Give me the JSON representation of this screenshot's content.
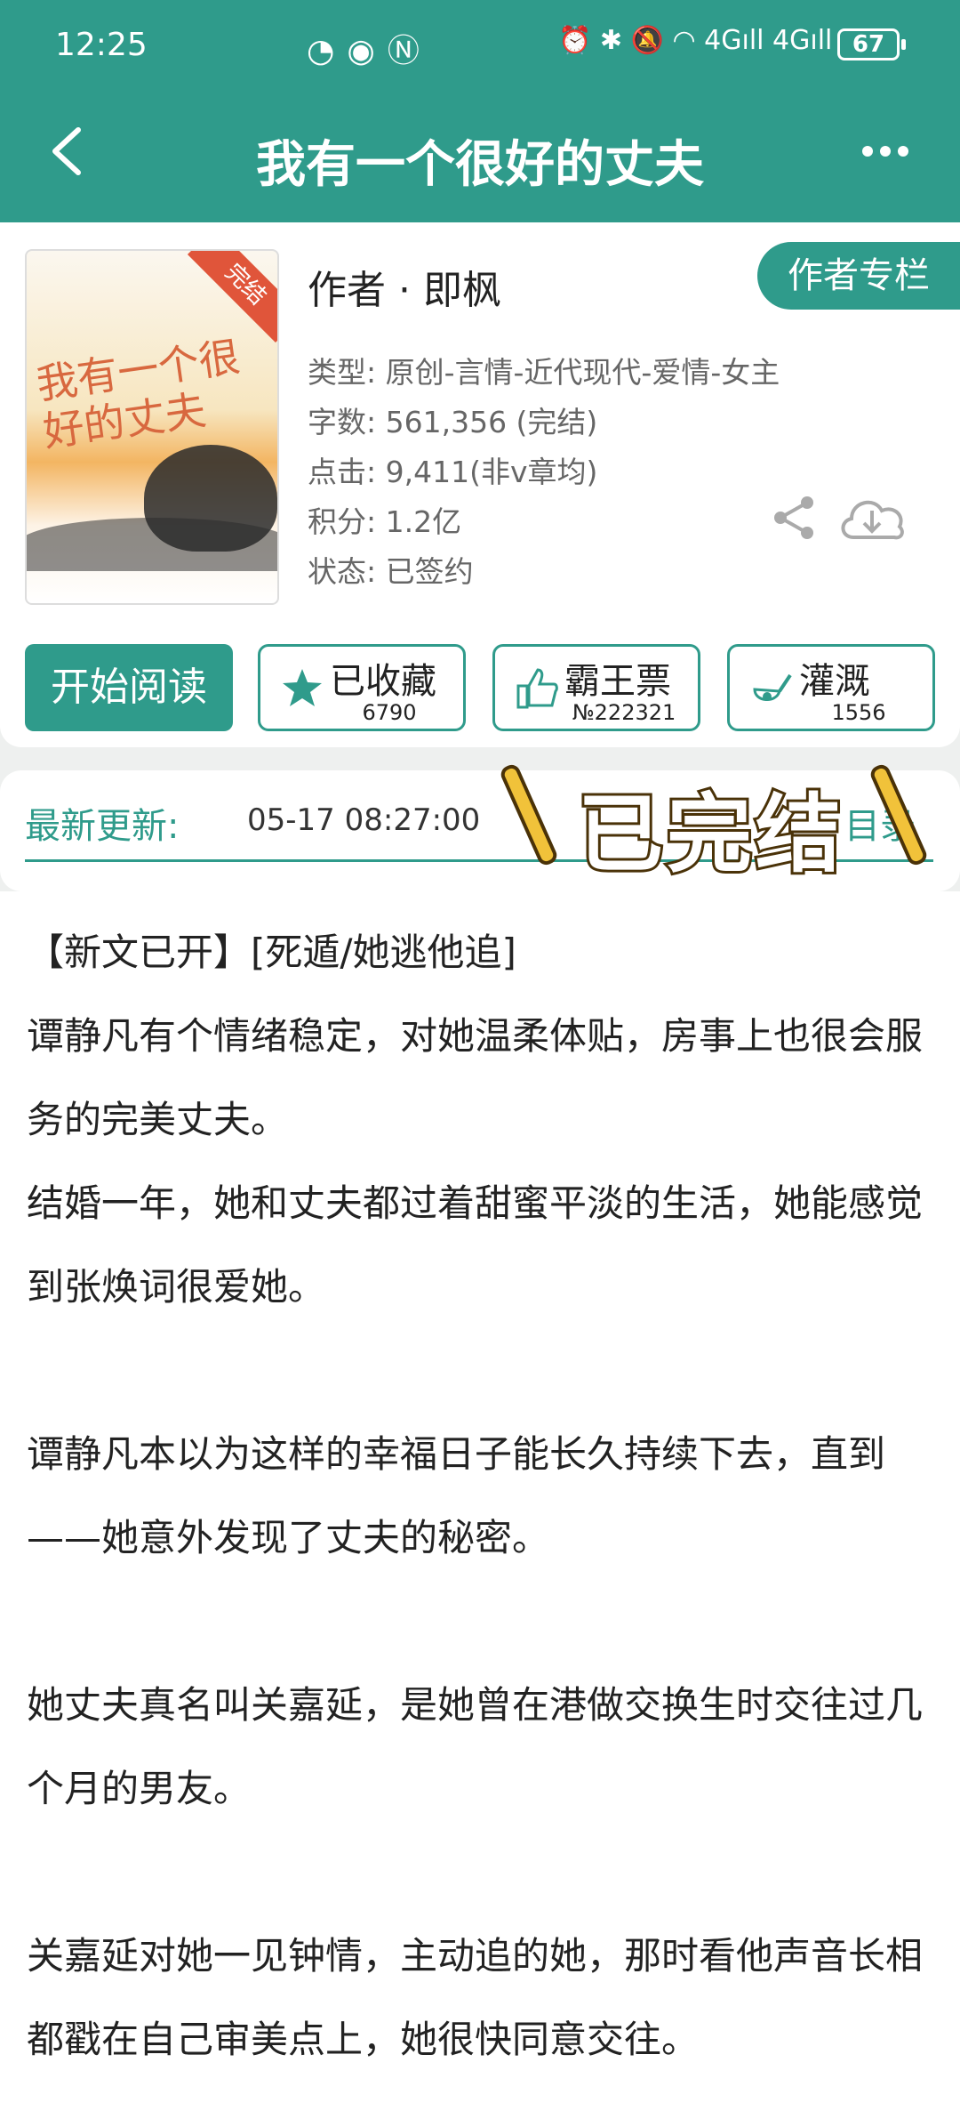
{
  "status_bar": {
    "time": "12:25",
    "battery": "67"
  },
  "header": {
    "title": "我有一个很好的丈夫"
  },
  "book": {
    "cover_ribbon": "完结",
    "cover_title": "我有一个很好的丈夫",
    "author": "作者 · 即枫",
    "author_column_label": "作者专栏",
    "info": {
      "type": "类型: 原创-言情-近代现代-爱情-女主",
      "words": "字数: 561,356 (完结)",
      "clicks": "点击: 9,411(非v章均)",
      "score": "积分: 1.2亿",
      "status": "状态: 已签约"
    }
  },
  "actions": {
    "read_label": "开始阅读",
    "collect": {
      "label": "已收藏",
      "count": "6790"
    },
    "vote": {
      "label": "霸王票",
      "count": "№222321"
    },
    "water": {
      "label": "灌溉",
      "count": "1556"
    }
  },
  "latest_update": {
    "label": "最新更新:",
    "time": "05-17 08:27:00",
    "toc_label": "目录",
    "stamp": "已完结"
  },
  "synopsis": [
    "【新文已开】[死遁/她逃他追]",
    "谭静凡有个情绪稳定，对她温柔体贴，房事上也很会服务的完美丈夫。",
    "结婚一年，她和丈夫都过着甜蜜平淡的生活，她能感觉到张焕词很爱她。",
    "谭静凡本以为这样的幸福日子能长久持续下去，直到——她意外发现了丈夫的秘密。",
    "她丈夫真名叫关嘉延，是她曾在港做交换生时交往过几个月的男友。",
    "关嘉延对她一见钟情，主动追的她，那时看他声音长相都戳在自己审美点上，她很快同意交往。"
  ],
  "colors": {
    "accent": "#2f9b8b",
    "stamp_fill": "#f1c23a"
  }
}
